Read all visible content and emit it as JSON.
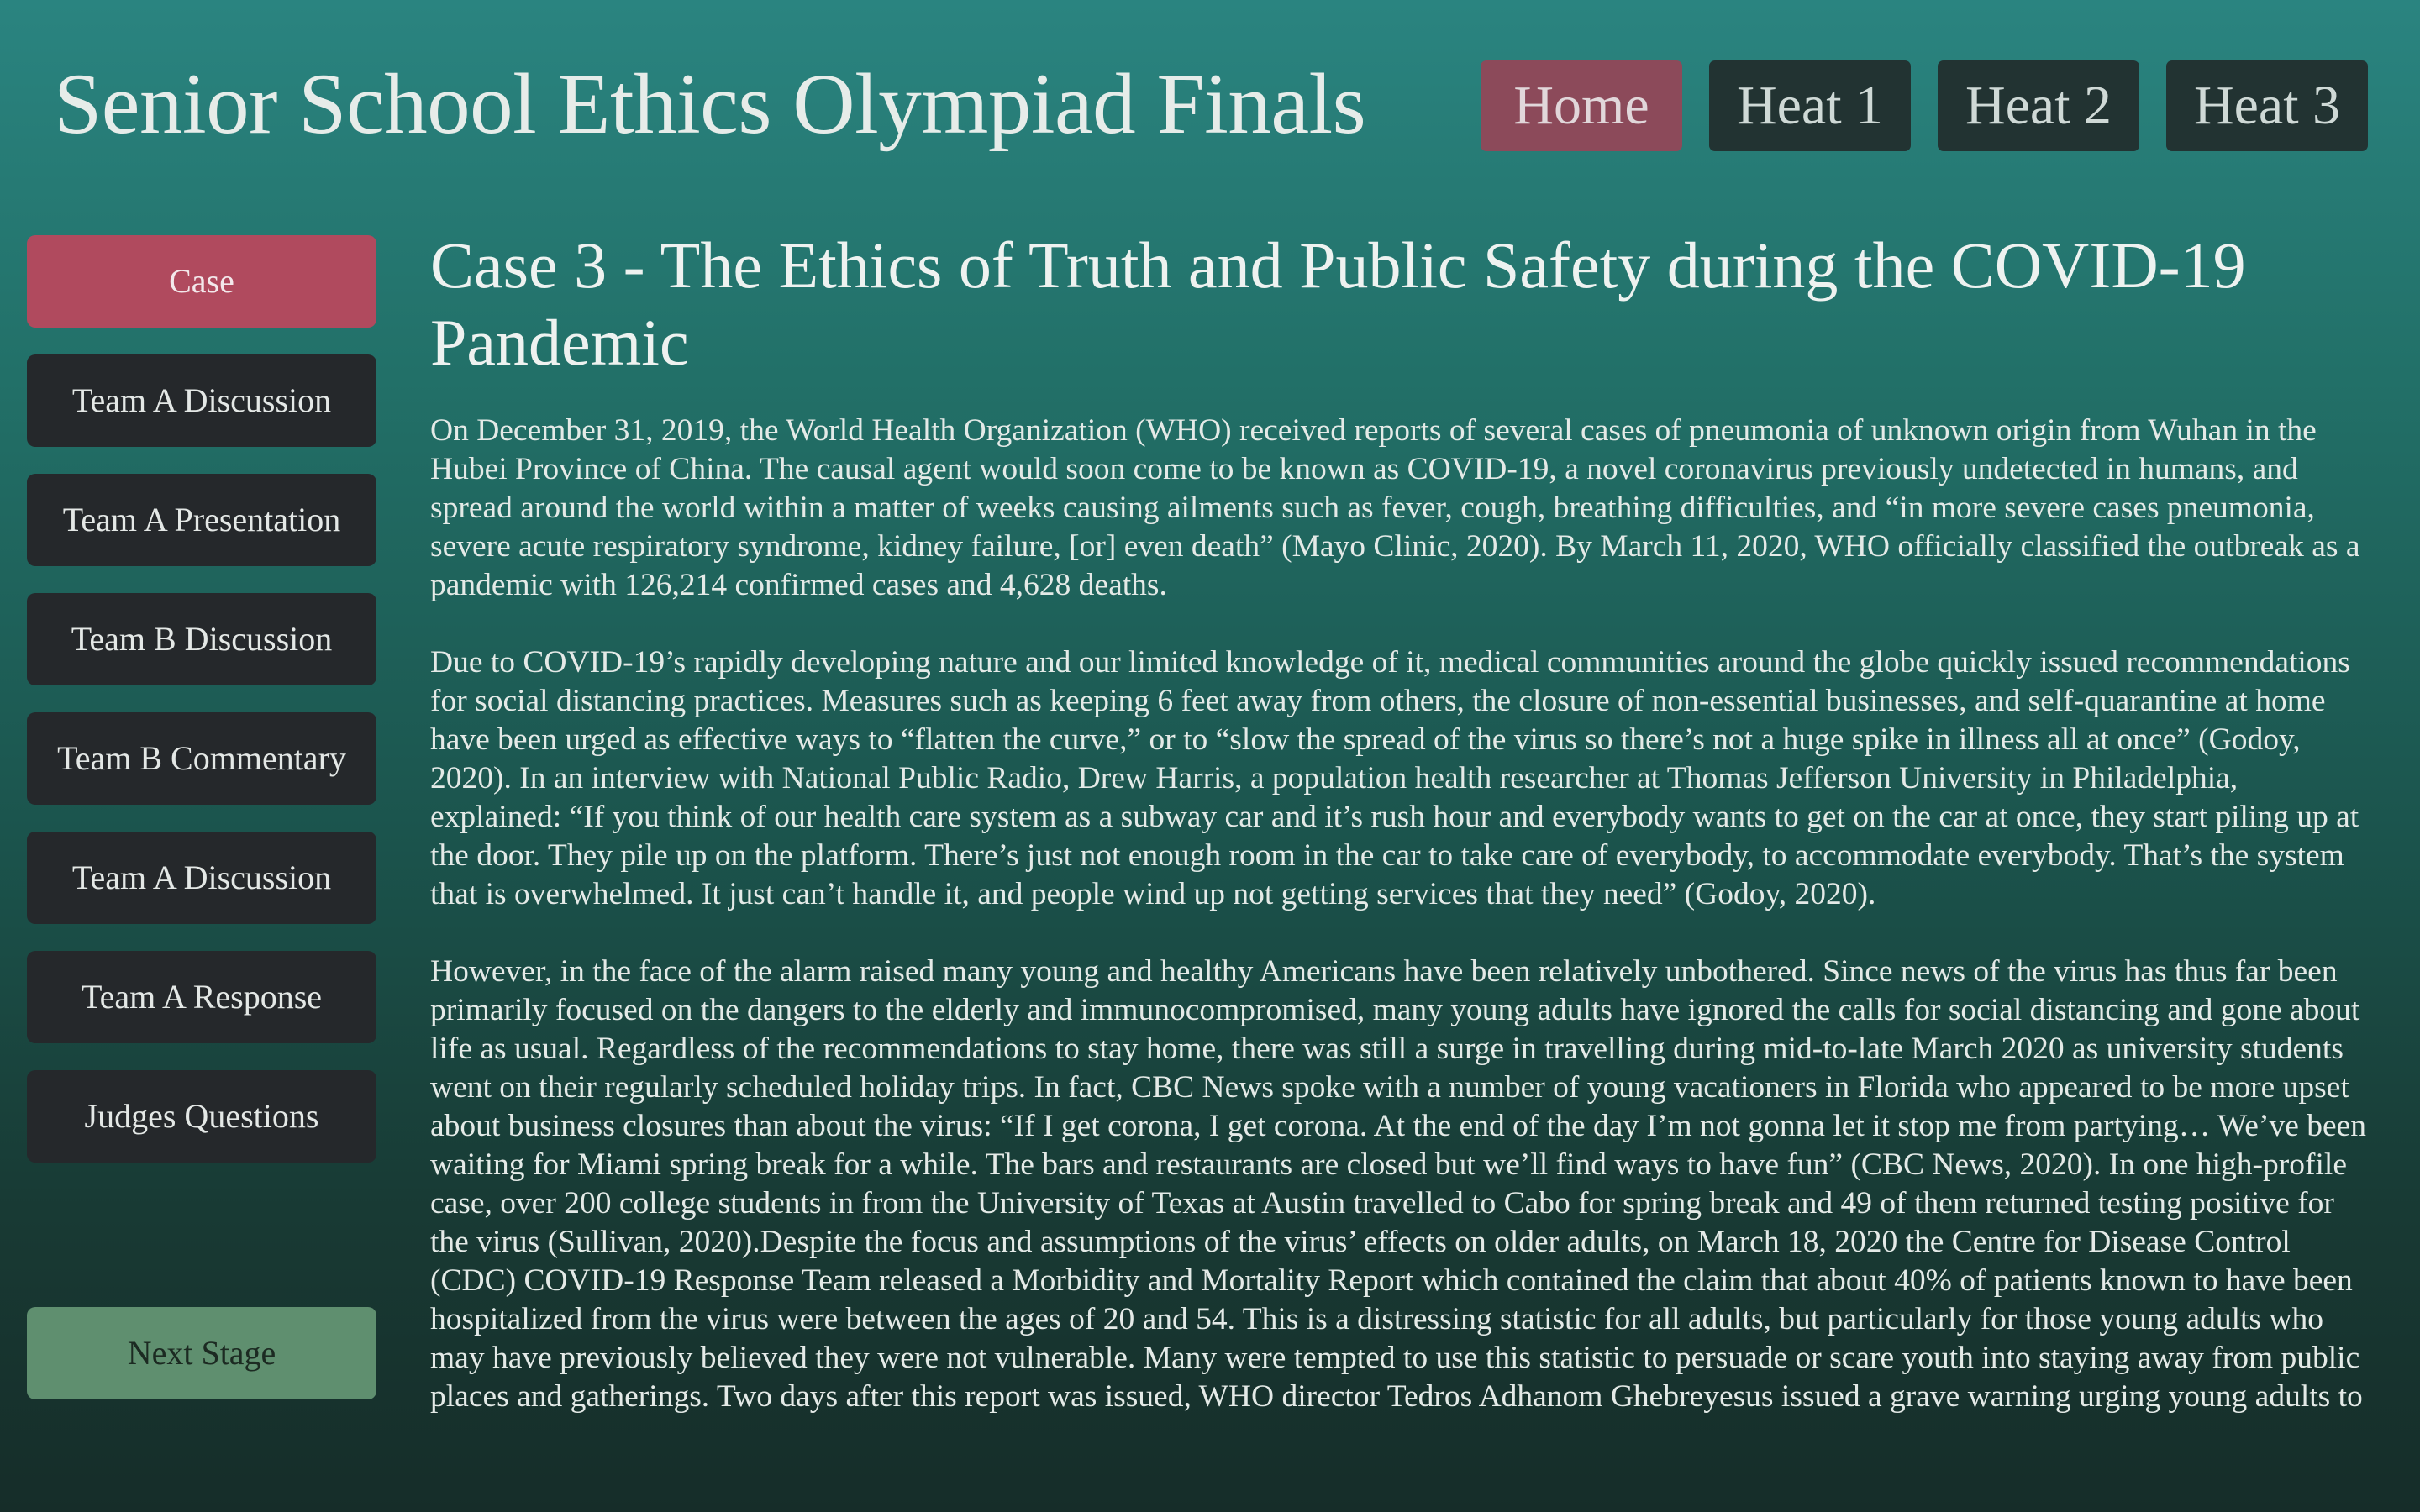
{
  "header": {
    "title": "Senior School Ethics Olympiad Finals",
    "tabs": [
      {
        "label": "Home",
        "active": true
      },
      {
        "label": "Heat 1",
        "active": false
      },
      {
        "label": "Heat 2",
        "active": false
      },
      {
        "label": "Heat 3",
        "active": false
      }
    ]
  },
  "sidebar": {
    "items": [
      {
        "label": "Case",
        "active": true
      },
      {
        "label": "Team A Discussion"
      },
      {
        "label": "Team A Presentation"
      },
      {
        "label": "Team B Discussion"
      },
      {
        "label": "Team B Commentary"
      },
      {
        "label": "Team A Discussion"
      },
      {
        "label": "Team A Response"
      },
      {
        "label": "Judges Questions"
      }
    ],
    "next_stage_label": "Next Stage"
  },
  "main": {
    "case_title": "Case 3 - The Ethics of Truth and Public Safety during the COVID-19 Pandemic",
    "paragraphs": [
      "On December 31, 2019, the World Health Organization (WHO) received reports of several cases of pneumonia of unknown origin from Wuhan in the Hubei Province of China. The causal agent would soon come to be known as COVID-19, a novel coronavirus previously undetected in humans, and spread around the world within a matter of weeks causing ailments such as fever, cough, breathing difficulties, and “in more severe cases pneumonia, severe acute respiratory syndrome, kidney failure, [or] even death” (Mayo Clinic, 2020). By March 11, 2020, WHO officially classified the outbreak as a pandemic with 126,214 confirmed cases and 4,628 deaths.",
      "Due to COVID-19’s rapidly developing nature and our limited knowledge of it, medical communities around the globe quickly issued recommendations for social distancing practices. Measures such as keeping 6 feet away from others, the closure of non-essential businesses, and self-quarantine at home have been urged as effective ways to “flatten the curve,” or to “slow the spread of the virus so there’s not a huge spike in illness all at once” (Godoy, 2020). In an interview with National Public Radio, Drew Harris, a population health researcher at Thomas Jefferson University in Philadelphia, explained: “If you think of our health care system as a subway car and it’s rush hour and everybody wants to get on the car at once, they start piling up at the door. They pile up on the platform. There’s just not enough room in the car to take care of everybody, to accommodate everybody. That’s the system that is overwhelmed. It just can’t handle it, and people wind up not getting services that they need” (Godoy, 2020).",
      "However, in the face of the alarm raised many young and healthy Americans have been relatively unbothered. Since news of the virus has thus far been primarily focused on the dangers to the elderly and immunocompromised, many young adults have ignored the calls for social distancing and gone about life as usual. Regardless of the recommendations to stay home, there was still a surge in travelling during mid-to-late March 2020 as university students went on their regularly scheduled holiday trips. In fact, CBC News spoke with a number of young vacationers in Florida who appeared to be more upset about business closures than about the virus: “If I get corona, I get corona. At the end of the day I’m not gonna let it stop me from partying… We’ve been waiting for Miami spring break for a while. The bars and restaurants are closed but we’ll find ways to have fun” (CBC News, 2020). In one high-profile case, over 200 college students in from the University of Texas at Austin travelled to Cabo for spring break and 49 of them returned testing positive for the virus (Sullivan, 2020).Despite the focus and assumptions of the virus’ effects on older adults, on March 18, 2020 the Centre for Disease Control (CDC) COVID-19 Response Team released a Morbidity and Mortality Report which contained the claim that about 40% of patients known to have been hospitalized from the virus were between the ages of 20 and 54. This is a distressing statistic for all adults, but particularly for those young adults who may have previously believed they were not vulnerable. Many were tempted to use this statistic to persuade or scare youth into staying away from public places and gatherings. Two days after this report was issued, WHO director Tedros Adhanom Ghebreyesus issued a grave warning urging young adults to"
    ]
  },
  "colors": {
    "active_tab": "#8c4a5a",
    "active_sidebar": "#b04a5e",
    "next_stage": "#5f8f6f",
    "inactive_button": "#25282b"
  }
}
